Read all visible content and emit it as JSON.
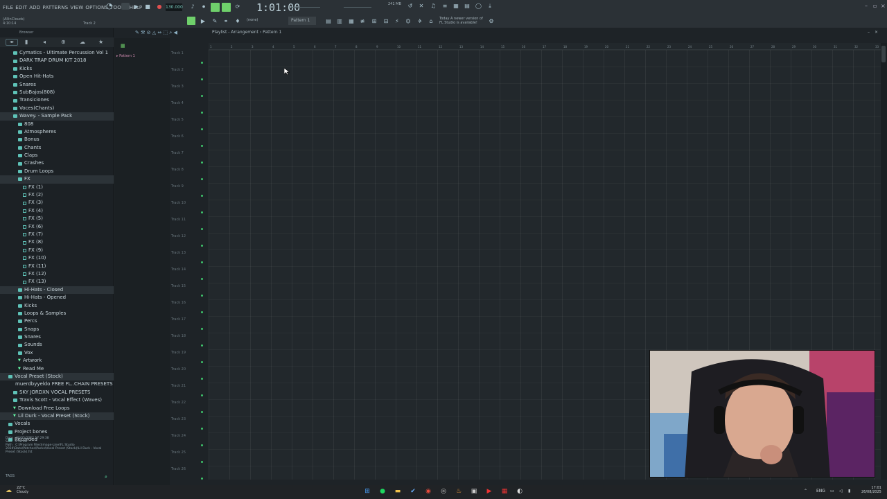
{
  "menu": [
    "FILE",
    "EDIT",
    "ADD",
    "PATTERNS",
    "VIEW",
    "OPTIONS",
    "TOOLS",
    "HELP"
  ],
  "hint": {
    "line1": "(AllinClouds)",
    "line2": "4:10:14",
    "track": "Track 2"
  },
  "transport": {
    "tempo": "130.000",
    "time": "1:01:00",
    "cpu": "241 MB"
  },
  "toolbar": {
    "pattern": "Pattern 1",
    "none": "(none)",
    "news_line1": "Today  A newer version of",
    "news_line2": "FL Studio is available!"
  },
  "browser": {
    "title": "Browser",
    "items": [
      {
        "label": "Cymatics - Ultimate Percussion Vol 1",
        "type": "folder",
        "indent": 1
      },
      {
        "label": "DARK TRAP DRUM KIT 2018",
        "type": "folder",
        "indent": 1
      },
      {
        "label": "Kicks",
        "type": "folder",
        "indent": 1
      },
      {
        "label": "Open Hit-Hats",
        "type": "folder",
        "indent": 1
      },
      {
        "label": "Snares",
        "type": "folder",
        "indent": 1
      },
      {
        "label": "SubBajos(808)",
        "type": "folder",
        "indent": 1
      },
      {
        "label": "Transiciones",
        "type": "folder",
        "indent": 1
      },
      {
        "label": "Voces(Chants)",
        "type": "folder",
        "indent": 1
      },
      {
        "label": "Wavey. - Sample Pack",
        "type": "folder",
        "indent": 1,
        "selected": true
      },
      {
        "label": "808",
        "type": "folder",
        "indent": 2
      },
      {
        "label": "Atmospheres",
        "type": "folder",
        "indent": 2
      },
      {
        "label": "Bonus",
        "type": "folder",
        "indent": 2
      },
      {
        "label": "Chants",
        "type": "folder",
        "indent": 2
      },
      {
        "label": "Claps",
        "type": "folder",
        "indent": 2
      },
      {
        "label": "Crashes",
        "type": "folder",
        "indent": 2
      },
      {
        "label": "Drum Loops",
        "type": "folder",
        "indent": 2
      },
      {
        "label": "FX",
        "type": "folder",
        "indent": 2,
        "selected": true
      },
      {
        "label": "FX (1)",
        "type": "file",
        "indent": 3
      },
      {
        "label": "FX (2)",
        "type": "file",
        "indent": 3
      },
      {
        "label": "FX (3)",
        "type": "file",
        "indent": 3
      },
      {
        "label": "FX (4)",
        "type": "file",
        "indent": 3
      },
      {
        "label": "FX (5)",
        "type": "file",
        "indent": 3
      },
      {
        "label": "FX (6)",
        "type": "file",
        "indent": 3
      },
      {
        "label": "FX (7)",
        "type": "file",
        "indent": 3
      },
      {
        "label": "FX (8)",
        "type": "file",
        "indent": 3
      },
      {
        "label": "FX (9)",
        "type": "file",
        "indent": 3
      },
      {
        "label": "FX (10)",
        "type": "file",
        "indent": 3
      },
      {
        "label": "FX (11)",
        "type": "file",
        "indent": 3
      },
      {
        "label": "FX (12)",
        "type": "file",
        "indent": 3
      },
      {
        "label": "FX (13)",
        "type": "file",
        "indent": 3
      },
      {
        "label": "Hi-Hats - Closed",
        "type": "folder",
        "indent": 2,
        "selected": true
      },
      {
        "label": "Hi-Hats - Opened",
        "type": "folder",
        "indent": 2
      },
      {
        "label": "Kicks",
        "type": "folder",
        "indent": 2
      },
      {
        "label": "Loops & Samples",
        "type": "folder",
        "indent": 2
      },
      {
        "label": "Percs",
        "type": "folder",
        "indent": 2
      },
      {
        "label": "Snaps",
        "type": "folder",
        "indent": 2
      },
      {
        "label": "Snares",
        "type": "folder",
        "indent": 2
      },
      {
        "label": "Sounds",
        "type": "folder",
        "indent": 2
      },
      {
        "label": "Vox",
        "type": "folder",
        "indent": 2
      },
      {
        "label": "Artwork",
        "type": "arrow",
        "indent": 2
      },
      {
        "label": "Read Me",
        "type": "arrow",
        "indent": 2
      },
      {
        "label": "Vocal Preset (Stock)",
        "type": "folder",
        "indent": 0,
        "selected": true
      },
      {
        "label": "muerdbyyeldo FREE FL..CHAIN PRESETS VOL. 2",
        "type": "folder",
        "indent": 1
      },
      {
        "label": "SKY JORDXN VOCAL PRESETS",
        "type": "folder",
        "indent": 1
      },
      {
        "label": "Travis Scott - Vocal Effect (Waves)",
        "type": "folder",
        "indent": 1
      },
      {
        "label": "Download Free Loops",
        "type": "arrow",
        "indent": 1
      },
      {
        "label": "Lil Durk - Vocal Preset (Stock)",
        "type": "arrow",
        "indent": 1,
        "selected": true
      },
      {
        "label": "Vocals",
        "type": "folder",
        "indent": 0
      },
      {
        "label": "Project bones",
        "type": "folder",
        "indent": 0
      },
      {
        "label": "Recorded",
        "type": "folder",
        "indent": 0
      }
    ],
    "info": {
      "date_label": "Date",
      "date": "30/05/2022 17:29:38",
      "size_label": "Size",
      "size": "4.58 KB",
      "path_label": "Path",
      "path": "C:\\Program Files\\Image-Line\\FL Studio 2024\\Data\\Patches\\Packs\\Vocal Preset (Stock)\\Lil Durk - Vocal Preset (Stock).fst"
    },
    "tags": "TAGS"
  },
  "playlist": {
    "breadcrumb": "Playlist - Arrangement › Pattern 1",
    "pattern_item": "Pattern 1",
    "tracks": [
      "Track 1",
      "Track 2",
      "Track 3",
      "Track 4",
      "Track 5",
      "Track 6",
      "Track 7",
      "Track 8",
      "Track 9",
      "Track 10",
      "Track 11",
      "Track 12",
      "Track 13",
      "Track 14",
      "Track 15",
      "Track 16",
      "Track 17",
      "Track 18",
      "Track 19",
      "Track 20",
      "Track 21",
      "Track 22",
      "Track 23",
      "Track 24",
      "Track 25",
      "Track 26"
    ],
    "ruler": [
      "1",
      "2",
      "3",
      "4",
      "5",
      "6",
      "7",
      "8",
      "9",
      "10",
      "11",
      "12",
      "13",
      "14",
      "15",
      "16",
      "17",
      "18",
      "19",
      "20",
      "21",
      "22",
      "23",
      "24",
      "25",
      "26",
      "27",
      "28",
      "29",
      "30",
      "31",
      "32",
      "33"
    ]
  },
  "taskbar": {
    "weather_temp": "22°C",
    "weather_desc": "Cloudy",
    "lang": "ENG",
    "time": "17:01",
    "date": "26/08/2025"
  },
  "colors": {
    "accent": "#6fd06b",
    "folder": "#5ec2b7",
    "pattern": "#d08ab0"
  }
}
